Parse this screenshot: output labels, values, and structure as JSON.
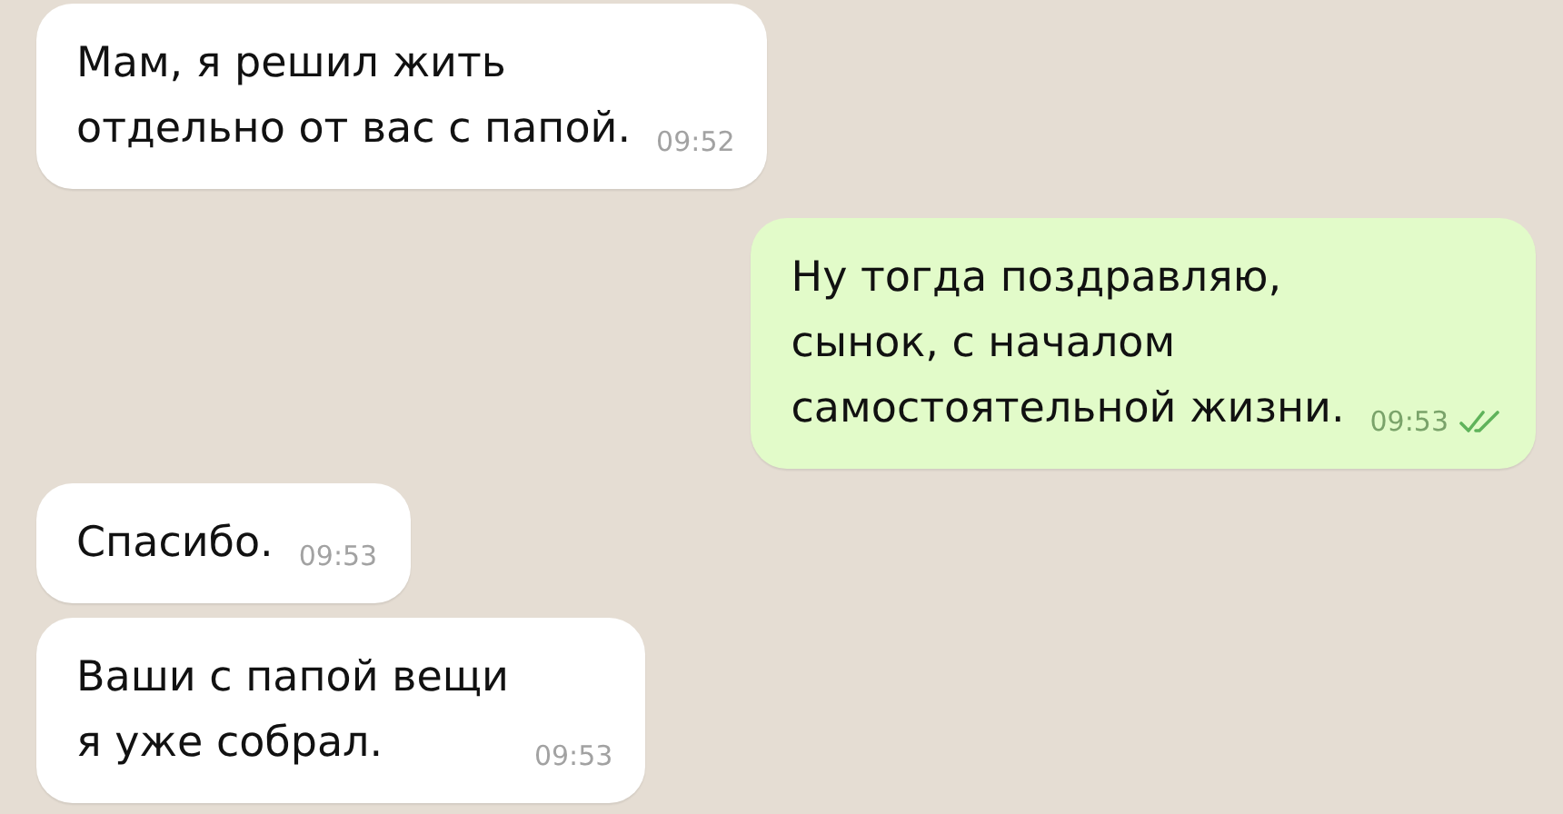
{
  "messages": [
    {
      "kind": "in",
      "text": "Мам, я решил жить\nотдельно от вас с папой.",
      "time": "09:52"
    },
    {
      "kind": "out",
      "text": "Ну тогда поздравляю,\nсынок, с началом\nсамостоятельной жизни.",
      "time": "09:53",
      "read": true
    },
    {
      "kind": "in",
      "text": "Спасибо.",
      "time": "09:53"
    },
    {
      "kind": "in",
      "text": "Ваши с папой вещи\nя уже собрал.",
      "time": "09:53"
    }
  ]
}
